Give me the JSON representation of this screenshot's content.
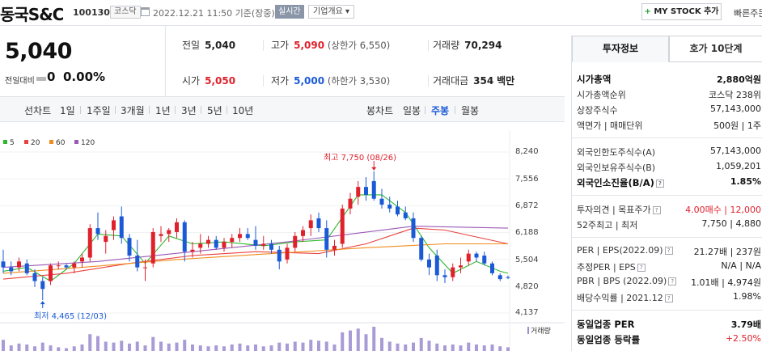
{
  "header": {
    "company_name": "동국S&C",
    "code": "100130",
    "market": "코스닥",
    "date": "2022.12.21 11:50 기준(장중)",
    "realtime": "실시간",
    "overview": "기업개요",
    "mystock_label": "MY STOCK 추가",
    "quick_order": "빠른주문"
  },
  "summary": {
    "price": "5,040",
    "change_label": "전일대비",
    "change_value": "0",
    "change_pct": "0.00%"
  },
  "stats": {
    "prev_close_label": "전일",
    "prev_close": "5,040",
    "high_label": "고가",
    "high": "5,090",
    "upper_limit": "(상한가 6,550)",
    "volume_label": "거래량",
    "volume": "70,294",
    "open_label": "시가",
    "open": "5,050",
    "low_label": "저가",
    "low": "5,000",
    "lower_limit": "(하한가 3,530)",
    "amount_label": "거래대금",
    "amount": "354",
    "amount_unit": "백만"
  },
  "chart_tabs": {
    "line_label": "선차트",
    "line_periods": [
      "1일",
      "1주일",
      "3개월",
      "1년",
      "3년",
      "5년",
      "10년"
    ],
    "candle_label": "봉차트",
    "candle_periods": [
      "일봉",
      "주봉",
      "월봉"
    ],
    "active_candle": "주봉"
  },
  "chart_data": {
    "type": "candlestick",
    "period": "weekly",
    "y_ticks": [
      "8,240",
      "7,556",
      "6,872",
      "6,188",
      "5,504",
      "4,820",
      "4,137"
    ],
    "ylim": [
      4137,
      8240
    ],
    "legend": [
      {
        "name": "5",
        "color": "#2eb82e"
      },
      {
        "name": "20",
        "color": "#e8423f"
      },
      {
        "name": "60",
        "color": "#f08c1e"
      },
      {
        "name": "120",
        "color": "#9b59b6"
      }
    ],
    "high_annotation": "최고 7,750 (08/26)",
    "low_annotation": "최저 4,465 (12/03)",
    "volume_label": "거래량",
    "candles": [
      {
        "o": 5450,
        "h": 5750,
        "l": 5150,
        "c": 5300
      },
      {
        "o": 5300,
        "h": 5450,
        "l": 5100,
        "c": 5200
      },
      {
        "o": 5300,
        "h": 5550,
        "l": 5200,
        "c": 5450
      },
      {
        "o": 5400,
        "h": 5500,
        "l": 5100,
        "c": 5150
      },
      {
        "o": 5150,
        "h": 5250,
        "l": 4800,
        "c": 4950
      },
      {
        "o": 4950,
        "h": 5050,
        "l": 4465,
        "c": 4750
      },
      {
        "o": 4950,
        "h": 5400,
        "l": 4850,
        "c": 5350
      },
      {
        "o": 5350,
        "h": 5450,
        "l": 5250,
        "c": 5350
      },
      {
        "o": 5350,
        "h": 5400,
        "l": 5250,
        "c": 5300
      },
      {
        "o": 5300,
        "h": 5450,
        "l": 5150,
        "c": 5400
      },
      {
        "o": 5450,
        "h": 5650,
        "l": 5300,
        "c": 5550
      },
      {
        "o": 5550,
        "h": 6400,
        "l": 5450,
        "c": 6300
      },
      {
        "o": 6300,
        "h": 6700,
        "l": 6000,
        "c": 6150
      },
      {
        "o": 5950,
        "h": 6250,
        "l": 5650,
        "c": 6100
      },
      {
        "o": 6250,
        "h": 6600,
        "l": 6000,
        "c": 6500
      },
      {
        "o": 6600,
        "h": 6850,
        "l": 5900,
        "c": 6050
      },
      {
        "o": 6050,
        "h": 6150,
        "l": 5450,
        "c": 5600
      },
      {
        "o": 5600,
        "h": 6000,
        "l": 5200,
        "c": 5300
      },
      {
        "o": 5300,
        "h": 5500,
        "l": 4950,
        "c": 5300
      },
      {
        "o": 5400,
        "h": 6300,
        "l": 5300,
        "c": 6200
      },
      {
        "o": 6100,
        "h": 6350,
        "l": 5950,
        "c": 6150
      },
      {
        "o": 6150,
        "h": 6300,
        "l": 5950,
        "c": 6250
      },
      {
        "o": 6200,
        "h": 6550,
        "l": 6050,
        "c": 6450
      },
      {
        "o": 6450,
        "h": 6500,
        "l": 5450,
        "c": 5700
      },
      {
        "o": 5700,
        "h": 5950,
        "l": 5550,
        "c": 5750
      },
      {
        "o": 5800,
        "h": 6150,
        "l": 5650,
        "c": 5900
      },
      {
        "o": 5900,
        "h": 6100,
        "l": 5800,
        "c": 6000
      },
      {
        "o": 6000,
        "h": 6100,
        "l": 5750,
        "c": 5800
      },
      {
        "o": 5800,
        "h": 6050,
        "l": 5700,
        "c": 5950
      },
      {
        "o": 5950,
        "h": 6150,
        "l": 5800,
        "c": 6050
      },
      {
        "o": 6050,
        "h": 6300,
        "l": 5950,
        "c": 6150
      },
      {
        "o": 6150,
        "h": 6300,
        "l": 6000,
        "c": 6050
      },
      {
        "o": 6000,
        "h": 6350,
        "l": 5750,
        "c": 5850
      },
      {
        "o": 5850,
        "h": 6100,
        "l": 5750,
        "c": 5900
      },
      {
        "o": 5900,
        "h": 6000,
        "l": 5650,
        "c": 5750
      },
      {
        "o": 5750,
        "h": 5850,
        "l": 5250,
        "c": 5450
      },
      {
        "o": 5500,
        "h": 5900,
        "l": 5400,
        "c": 5800
      },
      {
        "o": 5800,
        "h": 6200,
        "l": 5700,
        "c": 6100
      },
      {
        "o": 6100,
        "h": 6350,
        "l": 5950,
        "c": 6250
      },
      {
        "o": 6300,
        "h": 6650,
        "l": 6100,
        "c": 6500
      },
      {
        "o": 6550,
        "h": 6700,
        "l": 6200,
        "c": 6300
      },
      {
        "o": 6300,
        "h": 6500,
        "l": 5550,
        "c": 5750
      },
      {
        "o": 5750,
        "h": 6000,
        "l": 5600,
        "c": 5850
      },
      {
        "o": 5900,
        "h": 6900,
        "l": 5800,
        "c": 6800
      },
      {
        "o": 6800,
        "h": 7200,
        "l": 6650,
        "c": 7050
      },
      {
        "o": 7100,
        "h": 7500,
        "l": 6900,
        "c": 7350
      },
      {
        "o": 7350,
        "h": 7600,
        "l": 7000,
        "c": 7150
      },
      {
        "o": 7500,
        "h": 7750,
        "l": 7000,
        "c": 7050
      },
      {
        "o": 7050,
        "h": 7300,
        "l": 6800,
        "c": 6900
      },
      {
        "o": 6900,
        "h": 7100,
        "l": 6700,
        "c": 6800
      },
      {
        "o": 6850,
        "h": 7000,
        "l": 6600,
        "c": 6650
      },
      {
        "o": 6700,
        "h": 6850,
        "l": 6500,
        "c": 6550
      },
      {
        "o": 6550,
        "h": 6700,
        "l": 5950,
        "c": 6050
      },
      {
        "o": 6050,
        "h": 6100,
        "l": 5450,
        "c": 5500
      },
      {
        "o": 5500,
        "h": 5650,
        "l": 5100,
        "c": 5300
      },
      {
        "o": 5600,
        "h": 5750,
        "l": 4950,
        "c": 5100
      },
      {
        "o": 5100,
        "h": 5250,
        "l": 4900,
        "c": 5050
      },
      {
        "o": 5050,
        "h": 5400,
        "l": 4950,
        "c": 5300
      },
      {
        "o": 5300,
        "h": 5550,
        "l": 5150,
        "c": 5350
      },
      {
        "o": 5450,
        "h": 5750,
        "l": 5350,
        "c": 5650
      },
      {
        "o": 5650,
        "h": 5700,
        "l": 5450,
        "c": 5550
      },
      {
        "o": 5600,
        "h": 5700,
        "l": 5350,
        "c": 5400
      },
      {
        "o": 5400,
        "h": 5450,
        "l": 5100,
        "c": 5150
      },
      {
        "o": 5100,
        "h": 5150,
        "l": 4950,
        "c": 5000
      },
      {
        "o": 5050,
        "h": 5090,
        "l": 5000,
        "c": 5040
      }
    ],
    "ma_lines": {
      "ma5": [
        [
          0,
          5200
        ],
        [
          3,
          5300
        ],
        [
          6,
          4950
        ],
        [
          9,
          5400
        ],
        [
          12,
          6150
        ],
        [
          15,
          6100
        ],
        [
          18,
          5400
        ],
        [
          21,
          6100
        ],
        [
          24,
          5900
        ],
        [
          28,
          5950
        ],
        [
          33,
          5850
        ],
        [
          37,
          5950
        ],
        [
          41,
          6000
        ],
        [
          45,
          7150
        ],
        [
          48,
          7150
        ],
        [
          51,
          6700
        ],
        [
          54,
          5800
        ],
        [
          57,
          5150
        ],
        [
          60,
          5450
        ],
        [
          63,
          5200
        ],
        [
          64,
          5150
        ]
      ],
      "ma20": [
        [
          0,
          5000
        ],
        [
          8,
          5150
        ],
        [
          16,
          5400
        ],
        [
          24,
          5600
        ],
        [
          32,
          5700
        ],
        [
          40,
          5650
        ],
        [
          46,
          5900
        ],
        [
          52,
          6300
        ],
        [
          56,
          6250
        ],
        [
          64,
          5900
        ]
      ],
      "ma60": [
        [
          0,
          5150
        ],
        [
          10,
          5300
        ],
        [
          22,
          5500
        ],
        [
          34,
          5650
        ],
        [
          46,
          5800
        ],
        [
          56,
          5900
        ],
        [
          64,
          5900
        ]
      ],
      "ma120": [
        [
          0,
          5300
        ],
        [
          12,
          5450
        ],
        [
          24,
          5700
        ],
        [
          36,
          5950
        ],
        [
          44,
          6150
        ],
        [
          52,
          6350
        ],
        [
          64,
          6300
        ]
      ]
    },
    "volume": [
      12,
      6,
      8,
      7,
      5,
      9,
      6,
      4,
      3,
      5,
      7,
      18,
      16,
      10,
      9,
      11,
      8,
      10,
      6,
      15,
      10,
      8,
      9,
      12,
      7,
      6,
      5,
      6,
      5,
      7,
      8,
      6,
      7,
      5,
      6,
      9,
      8,
      10,
      9,
      12,
      11,
      10,
      7,
      20,
      22,
      24,
      18,
      26,
      14,
      10,
      8,
      7,
      9,
      14,
      11,
      8,
      6,
      7,
      6,
      9,
      7,
      6,
      7,
      5,
      4
    ]
  },
  "side_panel": {
    "tab_invest": "투자정보",
    "tab_orderbook": "호가 10단계",
    "rows1": [
      {
        "label": "시가총액",
        "value": "2,880억원",
        "bold": true
      },
      {
        "label": "시가총액순위",
        "value": "코스닥 238위"
      },
      {
        "label": "상장주식수",
        "value": "57,143,000"
      },
      {
        "label": "액면가 | 매매단위",
        "value": "500원 | 1주"
      }
    ],
    "rows2": [
      {
        "label": "외국인한도주식수(A)",
        "value": "57,143,000"
      },
      {
        "label": "외국인보유주식수(B)",
        "value": "1,059,201"
      },
      {
        "label": "외국인소진율(B/A)",
        "value": "1.85%",
        "bold": true
      }
    ],
    "rows3": [
      {
        "label": "투자의견 | 목표주가",
        "value": "4.00매수 | 12,000"
      },
      {
        "label": "52주최고 | 최저",
        "value": "7,750 | 4,880"
      }
    ],
    "rows4": [
      {
        "label": "PER | EPS(2022.09)",
        "value": "21.27배 | 237원"
      },
      {
        "label": "추정PER | EPS",
        "value": "N/A | N/A"
      },
      {
        "label": "PBR | BPS (2022.09)",
        "value": "1.01배 | 4,974원"
      },
      {
        "label": "배당수익률 | 2021.12",
        "value": "1.98%"
      }
    ],
    "rows5": [
      {
        "label": "동일업종 PER",
        "value": "3.79배"
      },
      {
        "label": "동일업종 등락률",
        "value": "+2.50%"
      }
    ]
  }
}
